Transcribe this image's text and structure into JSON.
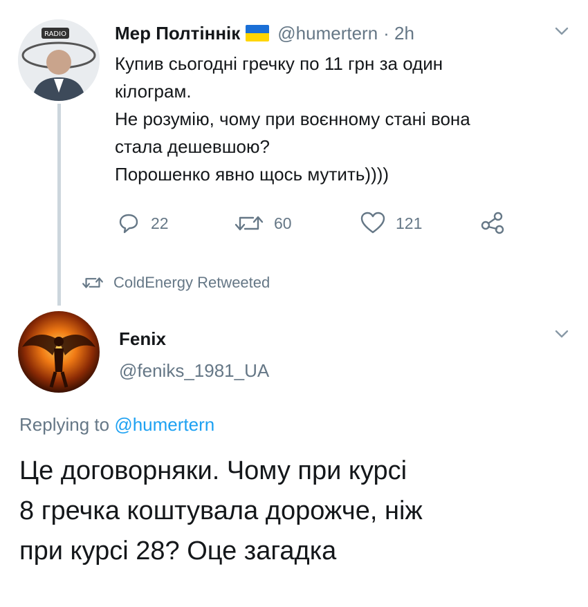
{
  "tweet1": {
    "display_name": "Мер Полтіннік",
    "handle": "@humertern",
    "time": "· 2h",
    "lines": [
      "Купив сьогодні гречку по 11 грн за один",
      "кілограм.",
      "Не розумію, чому при воєнному стані вона",
      "стала дешевшою?",
      "Порошенко явно щось мутить))))"
    ],
    "avatar_text": "RADIO",
    "actions": {
      "replies": "22",
      "retweets": "60",
      "likes": "121"
    }
  },
  "retweet_context": {
    "label": "ColdEnergy Retweeted"
  },
  "tweet2": {
    "display_name": "Fenix",
    "handle": "@feniks_1981_UA",
    "replying_prefix": "Replying to",
    "replying_handle": "@humertern",
    "lines": [
      "Це договорняки. Чому при курсі",
      "8 гречка коштувала дорожче, ніж",
      "при курсі 28? Оце загадка"
    ]
  },
  "colors": {
    "text": "#14171a",
    "muted": "#657786",
    "link": "#1da1f2",
    "thread_line": "#ccd6dd",
    "flag_blue": "#1a6fd6",
    "flag_yellow": "#ffd500"
  },
  "icons": [
    "reply-icon",
    "retweet-icon",
    "like-icon",
    "share-icon",
    "chevron-down-icon",
    "ukraine-flag-icon"
  ]
}
